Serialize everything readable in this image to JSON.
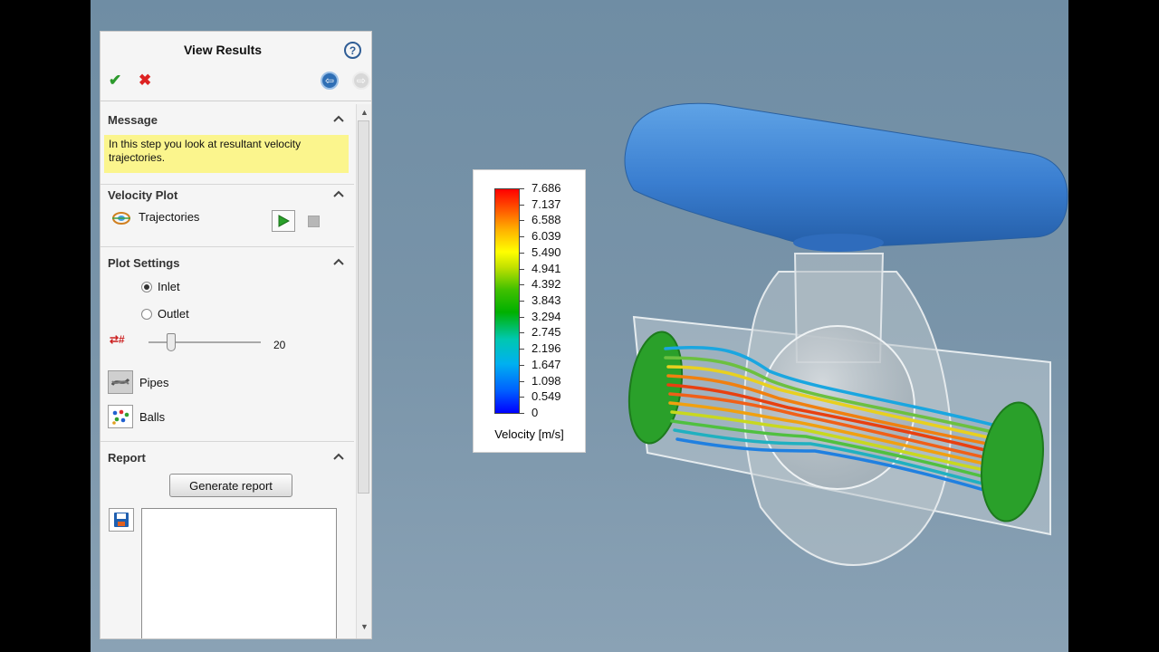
{
  "panel": {
    "title": "View Results",
    "icons": {
      "help": "help-icon",
      "ok": "check-icon",
      "cancel": "close-icon",
      "back": "back-arrow-icon",
      "forward": "forward-arrow-icon"
    },
    "help_glyph": "?"
  },
  "message": {
    "header": "Message",
    "text": "In this step you look at resultant velocity trajectories."
  },
  "velocity_plot": {
    "header": "Velocity Plot",
    "item_label": "Trajectories"
  },
  "plot_settings": {
    "header": "Plot Settings",
    "options": [
      {
        "label": "Inlet",
        "selected": true
      },
      {
        "label": "Outlet",
        "selected": false
      }
    ],
    "count_icon_glyph": "⇄#",
    "slider": {
      "value": 20,
      "min": 0,
      "max": 100
    },
    "slider_value_text": "20",
    "pipes_label": "Pipes",
    "balls_label": "Balls"
  },
  "report": {
    "header": "Report",
    "generate_label": "Generate report"
  },
  "legend": {
    "title": "Velocity [m/s]",
    "ticks": [
      "7.686",
      "7.137",
      "6.588",
      "6.039",
      "5.490",
      "4.941",
      "4.392",
      "3.843",
      "3.294",
      "2.745",
      "2.196",
      "1.647",
      "1.098",
      "0.549",
      "0"
    ],
    "colors": {
      "max": "#ff0000",
      "mid": "#00b000",
      "min": "#0000ff"
    }
  },
  "colors": {
    "viewport_bg": "#7994a9",
    "handle": "#3a7ed0",
    "inlet_face": "#2aa02a",
    "message_bg": "#fbf58d"
  }
}
